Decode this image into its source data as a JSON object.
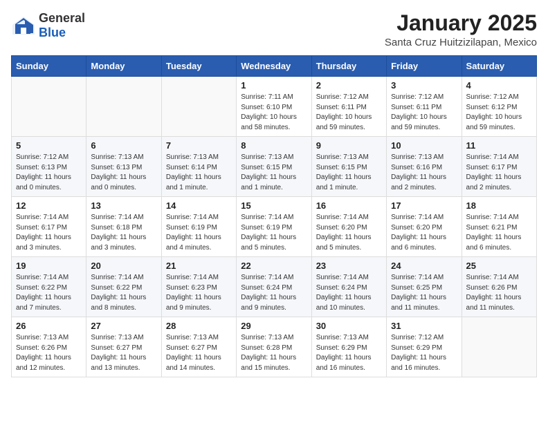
{
  "header": {
    "logo_general": "General",
    "logo_blue": "Blue",
    "month_title": "January 2025",
    "location": "Santa Cruz Huitzizilapan, Mexico"
  },
  "weekdays": [
    "Sunday",
    "Monday",
    "Tuesday",
    "Wednesday",
    "Thursday",
    "Friday",
    "Saturday"
  ],
  "weeks": [
    [
      {
        "day": "",
        "sunrise": "",
        "sunset": "",
        "daylight": ""
      },
      {
        "day": "",
        "sunrise": "",
        "sunset": "",
        "daylight": ""
      },
      {
        "day": "",
        "sunrise": "",
        "sunset": "",
        "daylight": ""
      },
      {
        "day": "1",
        "sunrise": "7:11 AM",
        "sunset": "6:10 PM",
        "daylight": "10 hours and 58 minutes."
      },
      {
        "day": "2",
        "sunrise": "7:12 AM",
        "sunset": "6:11 PM",
        "daylight": "10 hours and 59 minutes."
      },
      {
        "day": "3",
        "sunrise": "7:12 AM",
        "sunset": "6:11 PM",
        "daylight": "10 hours and 59 minutes."
      },
      {
        "day": "4",
        "sunrise": "7:12 AM",
        "sunset": "6:12 PM",
        "daylight": "10 hours and 59 minutes."
      }
    ],
    [
      {
        "day": "5",
        "sunrise": "7:12 AM",
        "sunset": "6:13 PM",
        "daylight": "11 hours and 0 minutes."
      },
      {
        "day": "6",
        "sunrise": "7:13 AM",
        "sunset": "6:13 PM",
        "daylight": "11 hours and 0 minutes."
      },
      {
        "day": "7",
        "sunrise": "7:13 AM",
        "sunset": "6:14 PM",
        "daylight": "11 hours and 1 minute."
      },
      {
        "day": "8",
        "sunrise": "7:13 AM",
        "sunset": "6:15 PM",
        "daylight": "11 hours and 1 minute."
      },
      {
        "day": "9",
        "sunrise": "7:13 AM",
        "sunset": "6:15 PM",
        "daylight": "11 hours and 1 minute."
      },
      {
        "day": "10",
        "sunrise": "7:13 AM",
        "sunset": "6:16 PM",
        "daylight": "11 hours and 2 minutes."
      },
      {
        "day": "11",
        "sunrise": "7:14 AM",
        "sunset": "6:17 PM",
        "daylight": "11 hours and 2 minutes."
      }
    ],
    [
      {
        "day": "12",
        "sunrise": "7:14 AM",
        "sunset": "6:17 PM",
        "daylight": "11 hours and 3 minutes."
      },
      {
        "day": "13",
        "sunrise": "7:14 AM",
        "sunset": "6:18 PM",
        "daylight": "11 hours and 3 minutes."
      },
      {
        "day": "14",
        "sunrise": "7:14 AM",
        "sunset": "6:19 PM",
        "daylight": "11 hours and 4 minutes."
      },
      {
        "day": "15",
        "sunrise": "7:14 AM",
        "sunset": "6:19 PM",
        "daylight": "11 hours and 5 minutes."
      },
      {
        "day": "16",
        "sunrise": "7:14 AM",
        "sunset": "6:20 PM",
        "daylight": "11 hours and 5 minutes."
      },
      {
        "day": "17",
        "sunrise": "7:14 AM",
        "sunset": "6:20 PM",
        "daylight": "11 hours and 6 minutes."
      },
      {
        "day": "18",
        "sunrise": "7:14 AM",
        "sunset": "6:21 PM",
        "daylight": "11 hours and 6 minutes."
      }
    ],
    [
      {
        "day": "19",
        "sunrise": "7:14 AM",
        "sunset": "6:22 PM",
        "daylight": "11 hours and 7 minutes."
      },
      {
        "day": "20",
        "sunrise": "7:14 AM",
        "sunset": "6:22 PM",
        "daylight": "11 hours and 8 minutes."
      },
      {
        "day": "21",
        "sunrise": "7:14 AM",
        "sunset": "6:23 PM",
        "daylight": "11 hours and 9 minutes."
      },
      {
        "day": "22",
        "sunrise": "7:14 AM",
        "sunset": "6:24 PM",
        "daylight": "11 hours and 9 minutes."
      },
      {
        "day": "23",
        "sunrise": "7:14 AM",
        "sunset": "6:24 PM",
        "daylight": "11 hours and 10 minutes."
      },
      {
        "day": "24",
        "sunrise": "7:14 AM",
        "sunset": "6:25 PM",
        "daylight": "11 hours and 11 minutes."
      },
      {
        "day": "25",
        "sunrise": "7:14 AM",
        "sunset": "6:26 PM",
        "daylight": "11 hours and 11 minutes."
      }
    ],
    [
      {
        "day": "26",
        "sunrise": "7:13 AM",
        "sunset": "6:26 PM",
        "daylight": "11 hours and 12 minutes."
      },
      {
        "day": "27",
        "sunrise": "7:13 AM",
        "sunset": "6:27 PM",
        "daylight": "11 hours and 13 minutes."
      },
      {
        "day": "28",
        "sunrise": "7:13 AM",
        "sunset": "6:27 PM",
        "daylight": "11 hours and 14 minutes."
      },
      {
        "day": "29",
        "sunrise": "7:13 AM",
        "sunset": "6:28 PM",
        "daylight": "11 hours and 15 minutes."
      },
      {
        "day": "30",
        "sunrise": "7:13 AM",
        "sunset": "6:29 PM",
        "daylight": "11 hours and 16 minutes."
      },
      {
        "day": "31",
        "sunrise": "7:12 AM",
        "sunset": "6:29 PM",
        "daylight": "11 hours and 16 minutes."
      },
      {
        "day": "",
        "sunrise": "",
        "sunset": "",
        "daylight": ""
      }
    ]
  ]
}
